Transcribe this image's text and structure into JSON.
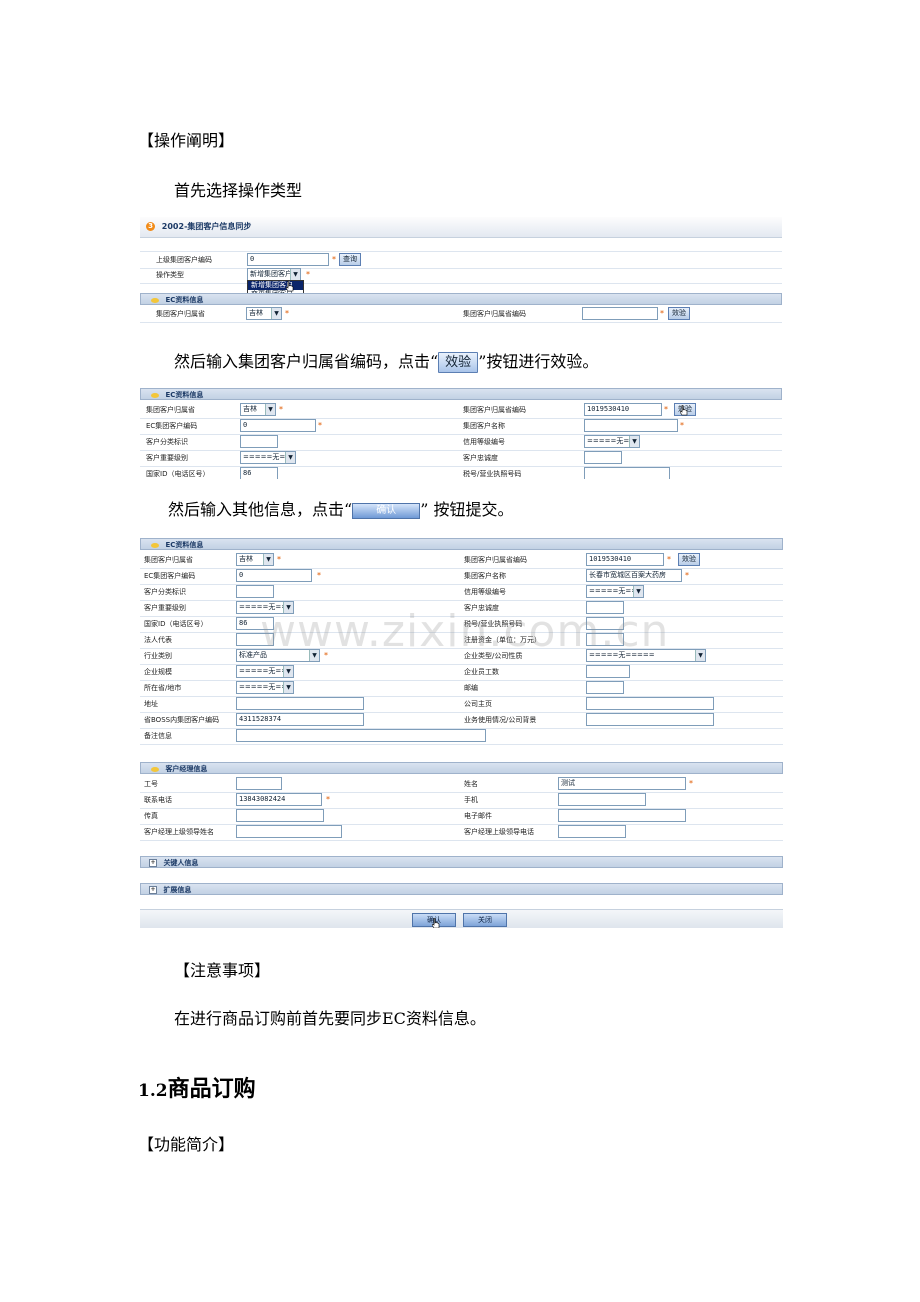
{
  "texts": {
    "heading_operation": "【操作阐明】",
    "step1": "首先选择操作类型",
    "step2_before": "然后输入集团客户归属省编码，点击“",
    "step2_btn": "效验",
    "step2_after": "”按钮进行效验。",
    "step3_before": "然后输入其他信息，点击“",
    "step3_btn": "确认",
    "step3_after": "” 按钮提交。",
    "heading_notes": "【注意事项】",
    "notes": "在进行商品订购前首先要同步EC资料信息。",
    "section_num": "1.2",
    "section_title": "商品订购",
    "heading_function": "【功能简介】",
    "watermark": "www.zixin.com.cn"
  },
  "shot1": {
    "title_num": "3",
    "title": "2002-集团客户信息同步",
    "label_upper_code": "上级集团客户编码",
    "upper_code_value": "0",
    "query_btn": "查询",
    "label_op_type": "操作类型",
    "op_type_value": "新增集团客户",
    "dropdown_options": [
      "新增集团客户",
      "变更集团客户"
    ],
    "ec_section": "EC资料信息",
    "label_province": "集团客户归属省",
    "province_value": "吉林",
    "label_province_code": "集团客户归属省编码",
    "verify_btn": "效验"
  },
  "shot2": {
    "ec_section": "EC资料信息",
    "label_province": "集团客户归属省",
    "province_value": "吉林",
    "label_province_code": "集团客户归属省编码",
    "province_code_value": "1019530410",
    "verify_btn": "效验",
    "label_ec_code": "EC集团客户编码",
    "ec_code_value": "0",
    "label_group_name": "集团客户名称",
    "label_class_mark": "客户分类标识",
    "label_credit_grade": "信用等级编号",
    "credit_grade_value": "=====无=====",
    "label_importance": "客户重要级别",
    "importance_value": "=====无=====",
    "label_loyalty": "客户忠诚度",
    "label_country_id": "国家ID（电话区号）",
    "country_id_value": "86",
    "label_tax_no": "税号/营业执照号码"
  },
  "shot3": {
    "ec_section": "EC资料信息",
    "rows": {
      "province_label": "集团客户归属省",
      "province_value": "吉林",
      "province_code_label": "集团客户归属省编码",
      "province_code_value": "1019530410",
      "verify_btn": "效验",
      "ec_code_label": "EC集团客户编码",
      "ec_code_value": "0",
      "group_name_label": "集团客户名称",
      "group_name_value": "长春市宽城区百案大药房",
      "class_mark_label": "客户分类标识",
      "credit_grade_label": "信用等级编号",
      "credit_grade_value": "=====无=====",
      "importance_label": "客户重要级别",
      "importance_value": "=====无=====",
      "loyalty_label": "客户忠诚度",
      "country_id_label": "国家ID（电话区号）",
      "country_id_value": "86",
      "tax_no_label": "税号/营业执照号码",
      "legal_rep_label": "法人代表",
      "capital_label": "注册资金（单位：万元）",
      "industry_label": "行业类别",
      "industry_value": "标准产品",
      "company_type_label": "企业类型/公司性质",
      "company_type_value": "=====无=====",
      "scale_label": "企业规模",
      "scale_value": "=====无=====",
      "staff_label": "企业员工数",
      "city_label": "所在省/地市",
      "city_value": "=====无=====",
      "postcode_label": "邮编",
      "address_label": "地址",
      "homepage_label": "公司主页",
      "boss_code_label": "省BOSS内集团客户编码",
      "boss_code_value": "4311528374",
      "business_label": "业务使用情况/公司背景",
      "remark_label": "备注信息"
    },
    "manager_section": "客户经理信息",
    "manager": {
      "job_no_label": "工号",
      "name_label": "姓名",
      "name_value": "测试",
      "phone_label": "联系电话",
      "phone_value": "13843082424",
      "mobile_label": "手机",
      "fax_label": "传真",
      "email_label": "电子邮件",
      "leader_name_label": "客户经理上级领导姓名",
      "leader_phone_label": "客户经理上级领导电话"
    },
    "key_person_section": "关键人信息",
    "extend_section": "扩展信息",
    "confirm_btn": "确认",
    "close_btn": "关闭"
  }
}
